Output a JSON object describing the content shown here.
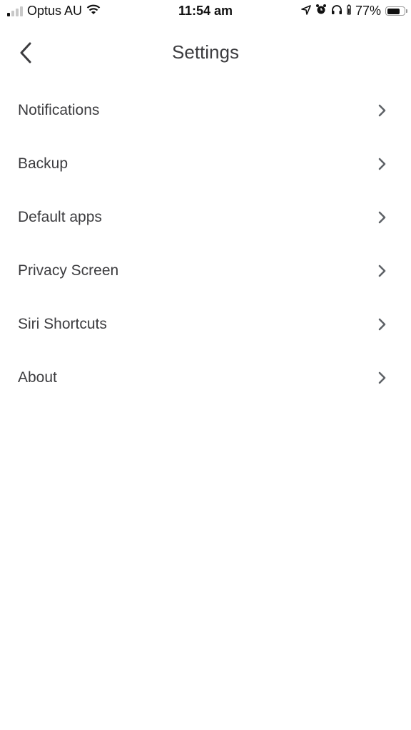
{
  "status_bar": {
    "carrier": "Optus AU",
    "time": "11:54 am",
    "battery_percent": "77%",
    "battery_level": 0.77,
    "signal_bars_on": 1,
    "signal_bars_total": 4,
    "icons": [
      "signal-icon",
      "wifi-icon",
      "location-icon",
      "alarm-icon",
      "headphones-icon",
      "headphones-battery-icon",
      "battery-icon"
    ]
  },
  "header": {
    "title": "Settings",
    "back_icon": "chevron-left-icon"
  },
  "settings": {
    "items": [
      {
        "label": "Notifications",
        "icon": "chevron-right-icon"
      },
      {
        "label": "Backup",
        "icon": "chevron-right-icon"
      },
      {
        "label": "Default apps",
        "icon": "chevron-right-icon"
      },
      {
        "label": "Privacy Screen",
        "icon": "chevron-right-icon"
      },
      {
        "label": "Siri Shortcuts",
        "icon": "chevron-right-icon"
      },
      {
        "label": "About",
        "icon": "chevron-right-icon"
      }
    ]
  }
}
